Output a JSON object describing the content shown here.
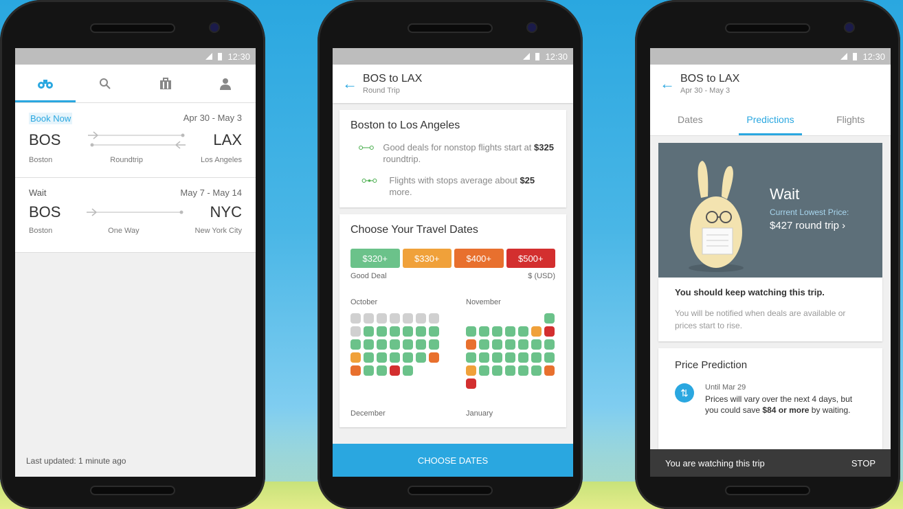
{
  "status": {
    "time": "12:30"
  },
  "screen1": {
    "tabs": [
      {
        "name": "binoculars-icon",
        "glyph": "⚭"
      },
      {
        "name": "search-icon",
        "glyph": "⌕"
      },
      {
        "name": "luggage-icon",
        "glyph": "▣"
      },
      {
        "name": "profile-icon",
        "glyph": "●"
      }
    ],
    "trips": [
      {
        "status": "Book Now",
        "dates": "Apr 30 - May 3",
        "from": "BOS",
        "to": "LAX",
        "from_city": "Boston",
        "type": "Roundtrip",
        "to_city": "Los Angeles"
      },
      {
        "status": "Wait",
        "dates": "May 7 - May 14",
        "from": "BOS",
        "to": "NYC",
        "from_city": "Boston",
        "type": "One Way",
        "to_city": "New York City"
      }
    ],
    "footer": "Last updated: 1 minute ago"
  },
  "screen2": {
    "title": "BOS to LAX",
    "subtitle": "Round Trip",
    "card1_title": "Boston to Los Angeles",
    "nonstop_text_a": "Good deals for nonstop flights start at",
    "nonstop_price": "$325",
    "nonstop_text_b": "roundtrip.",
    "stops_text_a": "Flights with stops average about",
    "stops_price": "$25",
    "stops_text_b": "more.",
    "card2_title": "Choose Your Travel Dates",
    "legend": [
      {
        "label": "$320+",
        "color": "#6bc28a"
      },
      {
        "label": "$330+",
        "color": "#f0a13a"
      },
      {
        "label": "$400+",
        "color": "#e8702e"
      },
      {
        "label": "$500+",
        "color": "#d32f2f"
      }
    ],
    "legend_left": "Good Deal",
    "legend_right": "$ (USD)",
    "month1": "October",
    "month2": "November",
    "month3": "December",
    "month4": "January",
    "cta": "CHOOSE DATES",
    "october_cells": [
      "g",
      "g",
      "g",
      "g",
      "g",
      "g",
      "g",
      "g",
      "gr",
      "gr",
      "gr",
      "gr",
      "gr",
      "gr",
      "gr",
      "gr",
      "gr",
      "gr",
      "gr",
      "gr",
      "gr",
      "o",
      "gr",
      "gr",
      "gr",
      "gr",
      "gr",
      "or",
      "or",
      "gr",
      "gr",
      "r",
      "gr",
      "e",
      "e"
    ],
    "november_cells": [
      "e",
      "e",
      "e",
      "e",
      "e",
      "e",
      "gr",
      "gr",
      "gr",
      "gr",
      "gr",
      "gr",
      "o",
      "r",
      "or",
      "gr",
      "gr",
      "gr",
      "gr",
      "gr",
      "gr",
      "gr",
      "gr",
      "gr",
      "gr",
      "gr",
      "gr",
      "gr",
      "o",
      "gr",
      "gr",
      "gr",
      "gr",
      "gr",
      "or",
      "r",
      "e",
      "e",
      "e",
      "e",
      "e",
      "e"
    ]
  },
  "screen3": {
    "title": "BOS to LAX",
    "subtitle": "Apr 30 - May 3",
    "tabs": [
      "Dates",
      "Predictions",
      "Flights"
    ],
    "wait": "Wait",
    "clp_label": "Current Lowest Price:",
    "price": "$427 round trip ›",
    "keep_watching": "You should keep watching this trip.",
    "notified": "You will be notified when deals are available or prices start to rise.",
    "pp_title": "Price Prediction",
    "until": "Until Mar 29",
    "msg_a": "Prices will vary over the next 4 days, but you could save",
    "msg_b": "$84 or more",
    "msg_c": "by waiting.",
    "snackbar_text": "You are watching this trip",
    "snackbar_action": "STOP"
  }
}
